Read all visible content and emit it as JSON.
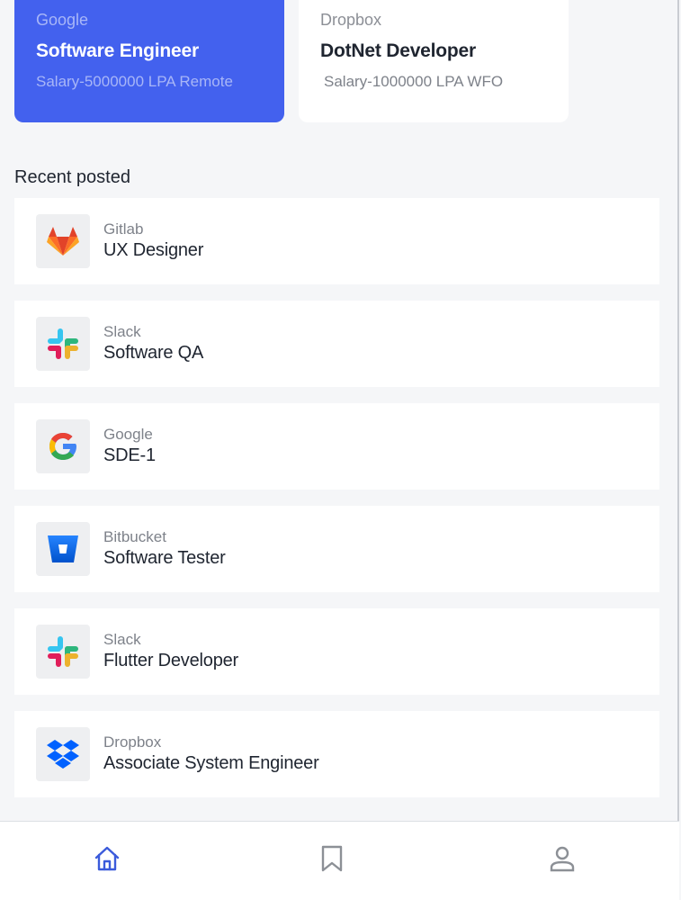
{
  "featured": [
    {
      "company": "Google",
      "title": "Software Engineer",
      "salary": "Salary-5000000 LPA Remote"
    },
    {
      "company": "Dropbox",
      "title": "DotNet Developer",
      "salary": "Salary-1000000 LPA WFO"
    }
  ],
  "recent": {
    "heading": "Recent posted",
    "jobs": [
      {
        "company": "Gitlab",
        "title": "UX Designer",
        "logo": "gitlab-logo"
      },
      {
        "company": "Slack",
        "title": "Software QA",
        "logo": "slack-logo"
      },
      {
        "company": "Google",
        "title": "SDE-1",
        "logo": "google-logo"
      },
      {
        "company": "Bitbucket",
        "title": "Software Tester",
        "logo": "bitbucket-logo"
      },
      {
        "company": "Slack",
        "title": "Flutter Developer",
        "logo": "slack-logo"
      },
      {
        "company": "Dropbox",
        "title": "Associate System Engineer",
        "logo": "dropbox-logo"
      }
    ]
  },
  "nav": {
    "items": [
      {
        "icon": "home-icon",
        "active": true
      },
      {
        "icon": "bookmark-icon",
        "active": false
      },
      {
        "icon": "profile-icon",
        "active": false
      }
    ],
    "active_color": "#3b5bdb",
    "inactive_color": "#8c9096"
  },
  "colors": {
    "accent": "#4361ee",
    "background": "#f5f6f8"
  }
}
